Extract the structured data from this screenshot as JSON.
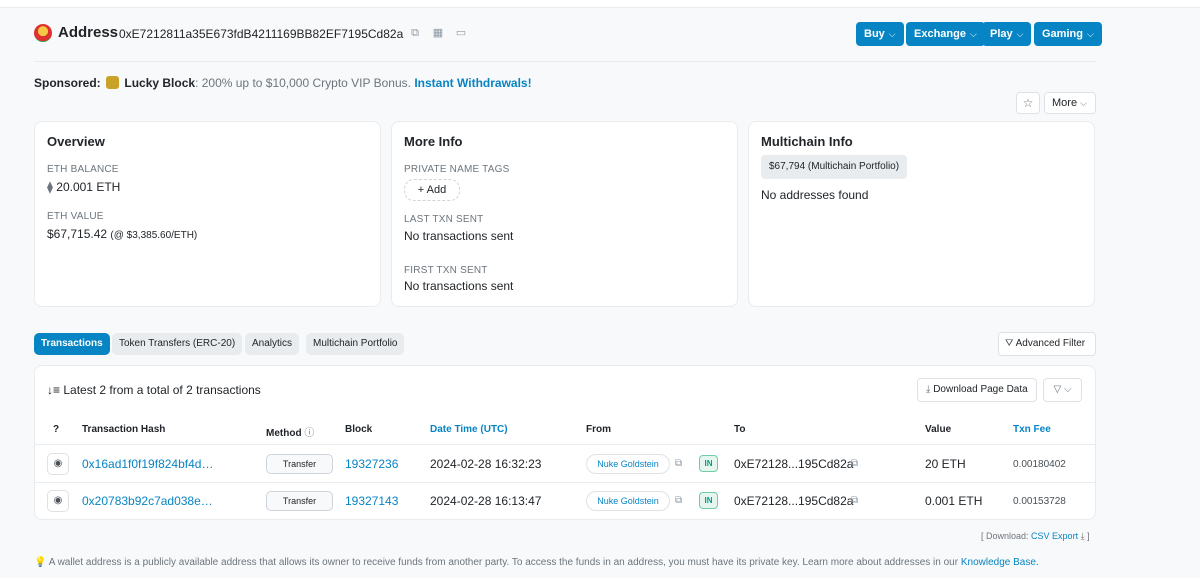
{
  "header": {
    "title": "Address",
    "address": "0xE7212811a35E673fdB4211169BB82EF7195Cd82a",
    "buttons": [
      "Buy",
      "Exchange",
      "Play",
      "Gaming"
    ]
  },
  "sponsored": {
    "label": "Sponsored:",
    "brand": "Lucky Block",
    "text": ": 200% up to $10,000 Crypto VIP Bonus.",
    "cta": "Instant Withdrawals!"
  },
  "actions": {
    "more_label": "More"
  },
  "overview": {
    "title": "Overview",
    "eth_balance_label": "ETH BALANCE",
    "eth_balance": "20.001 ETH",
    "eth_value_label": "ETH VALUE",
    "eth_value": "$67,715.42",
    "eth_rate": "(@ $3,385.60/ETH)"
  },
  "more_info": {
    "title": "More Info",
    "private_tags_label": "PRIVATE NAME TAGS",
    "add_label": "+ Add",
    "last_txn_label": "LAST TXN SENT",
    "last_txn": "No transactions sent",
    "first_txn_label": "FIRST TXN SENT",
    "first_txn": "No transactions sent"
  },
  "multichain": {
    "title": "Multichain Info",
    "portfolio_badge": "$67,794 (Multichain Portfolio)",
    "no_addresses": "No addresses found"
  },
  "tabs": [
    "Transactions",
    "Token Transfers (ERC-20)",
    "Analytics",
    "Multichain Portfolio"
  ],
  "advanced_filter": "Advanced Filter",
  "table": {
    "summary": "Latest 2 from a total of 2 transactions",
    "download_label": "Download Page Data",
    "headers": {
      "hash": "Transaction Hash",
      "method": "Method",
      "block": "Block",
      "date": "Date Time (UTC)",
      "from": "From",
      "to": "To",
      "value": "Value",
      "fee": "Txn Fee"
    },
    "rows": [
      {
        "hash": "0x16ad1f0f19f824bf4d…",
        "method": "Transfer",
        "block": "19327236",
        "date": "2024-02-28 16:32:23",
        "from": "Nuke Goldstein",
        "direction": "IN",
        "to": "0xE72128...195Cd82a",
        "value": "20 ETH",
        "fee": "0.00180402"
      },
      {
        "hash": "0x20783b92c7ad038e…",
        "method": "Transfer",
        "block": "19327143",
        "date": "2024-02-28 16:13:47",
        "from": "Nuke Goldstein",
        "direction": "IN",
        "to": "0xE72128...195Cd82a",
        "value": "0.001 ETH",
        "fee": "0.00153728"
      }
    ]
  },
  "csv": {
    "prefix": "[ Download:",
    "link": "CSV Export",
    "suffix": "]"
  },
  "footnote": {
    "text": "A wallet address is a publicly available address that allows its owner to receive funds from another party. To access the funds in an address, you must have its private key. Learn more about addresses in our",
    "link": "Knowledge Base."
  },
  "colors": {
    "accent": "#0784c3",
    "in_badge": "#00a186"
  }
}
